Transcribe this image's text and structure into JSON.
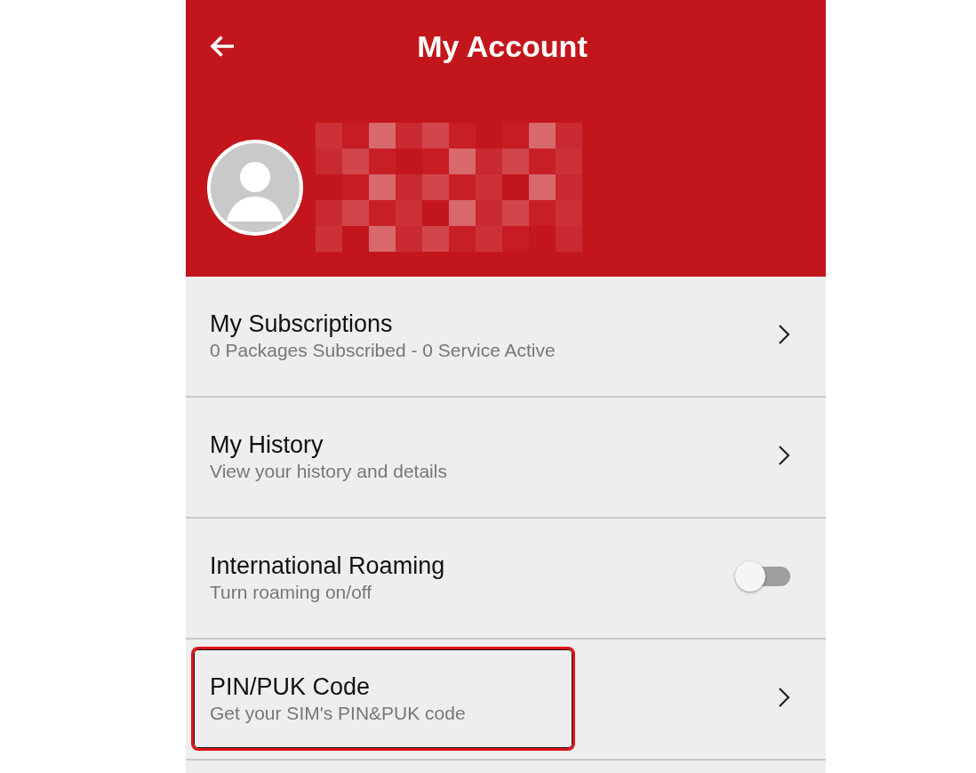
{
  "header": {
    "title": "My Account"
  },
  "menu": [
    {
      "kind": "link",
      "title": "My Subscriptions",
      "subtitle": "0 Packages Subscribed - 0 Service Active",
      "highlighted": false
    },
    {
      "kind": "link",
      "title": "My History",
      "subtitle": "View your history and details",
      "highlighted": false
    },
    {
      "kind": "toggle",
      "title": "International Roaming",
      "subtitle": "Turn roaming on/off",
      "on": false,
      "highlighted": false
    },
    {
      "kind": "link",
      "title": "PIN/PUK Code",
      "subtitle": "Get your SIM's PIN&PUK code",
      "highlighted": true
    }
  ]
}
